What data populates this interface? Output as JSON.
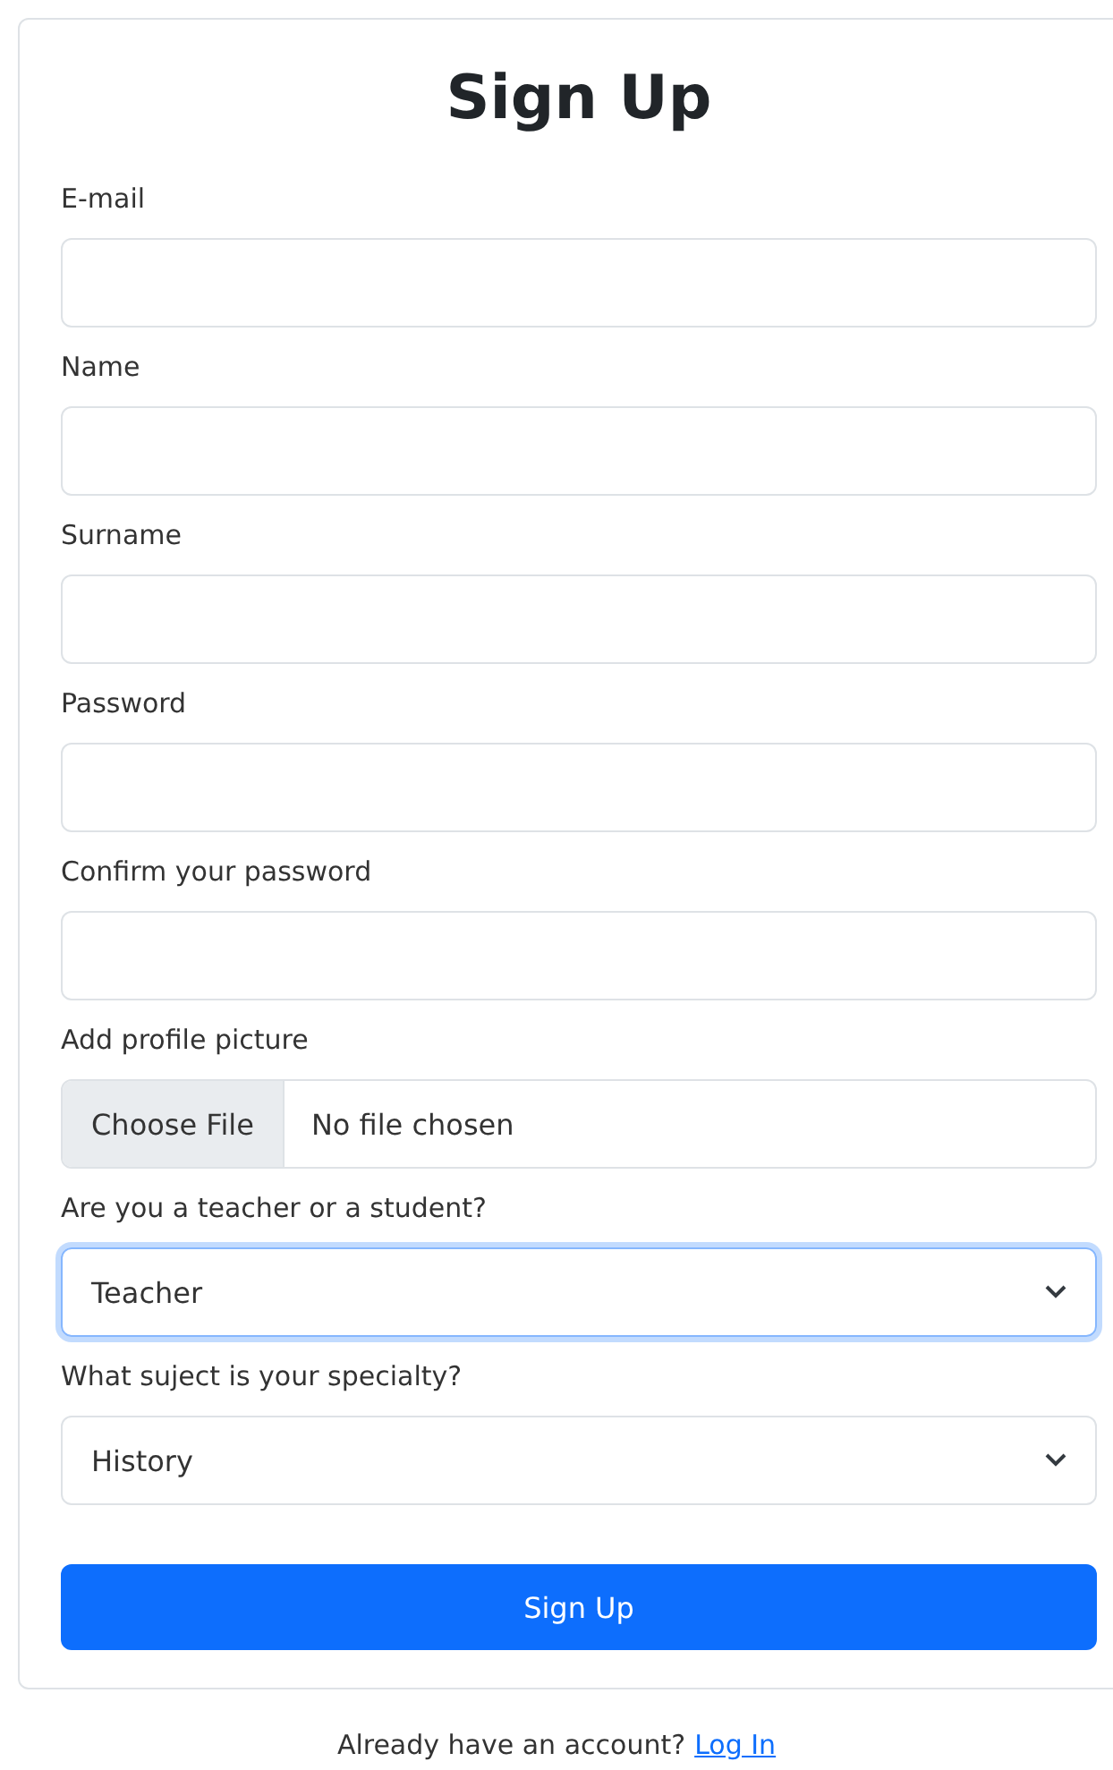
{
  "title": "Sign Up",
  "fields": [
    {
      "kind": "text",
      "label": "E-mail"
    },
    {
      "kind": "text",
      "label": "Name"
    },
    {
      "kind": "text",
      "label": "Surname"
    },
    {
      "kind": "password",
      "label": "Password"
    },
    {
      "kind": "password",
      "label": "Confirm your password"
    },
    {
      "kind": "file",
      "label": "Add profile picture",
      "button": "Choose File",
      "value": "No file chosen"
    },
    {
      "kind": "select",
      "label": "Are you a teacher or a student?",
      "value": "Teacher",
      "focused": true
    },
    {
      "kind": "select",
      "label": "What suject is your specialty?",
      "value": "History",
      "focused": false
    }
  ],
  "submit": "Sign Up",
  "footer": {
    "text": "Already have an account?",
    "link": "Log In"
  }
}
